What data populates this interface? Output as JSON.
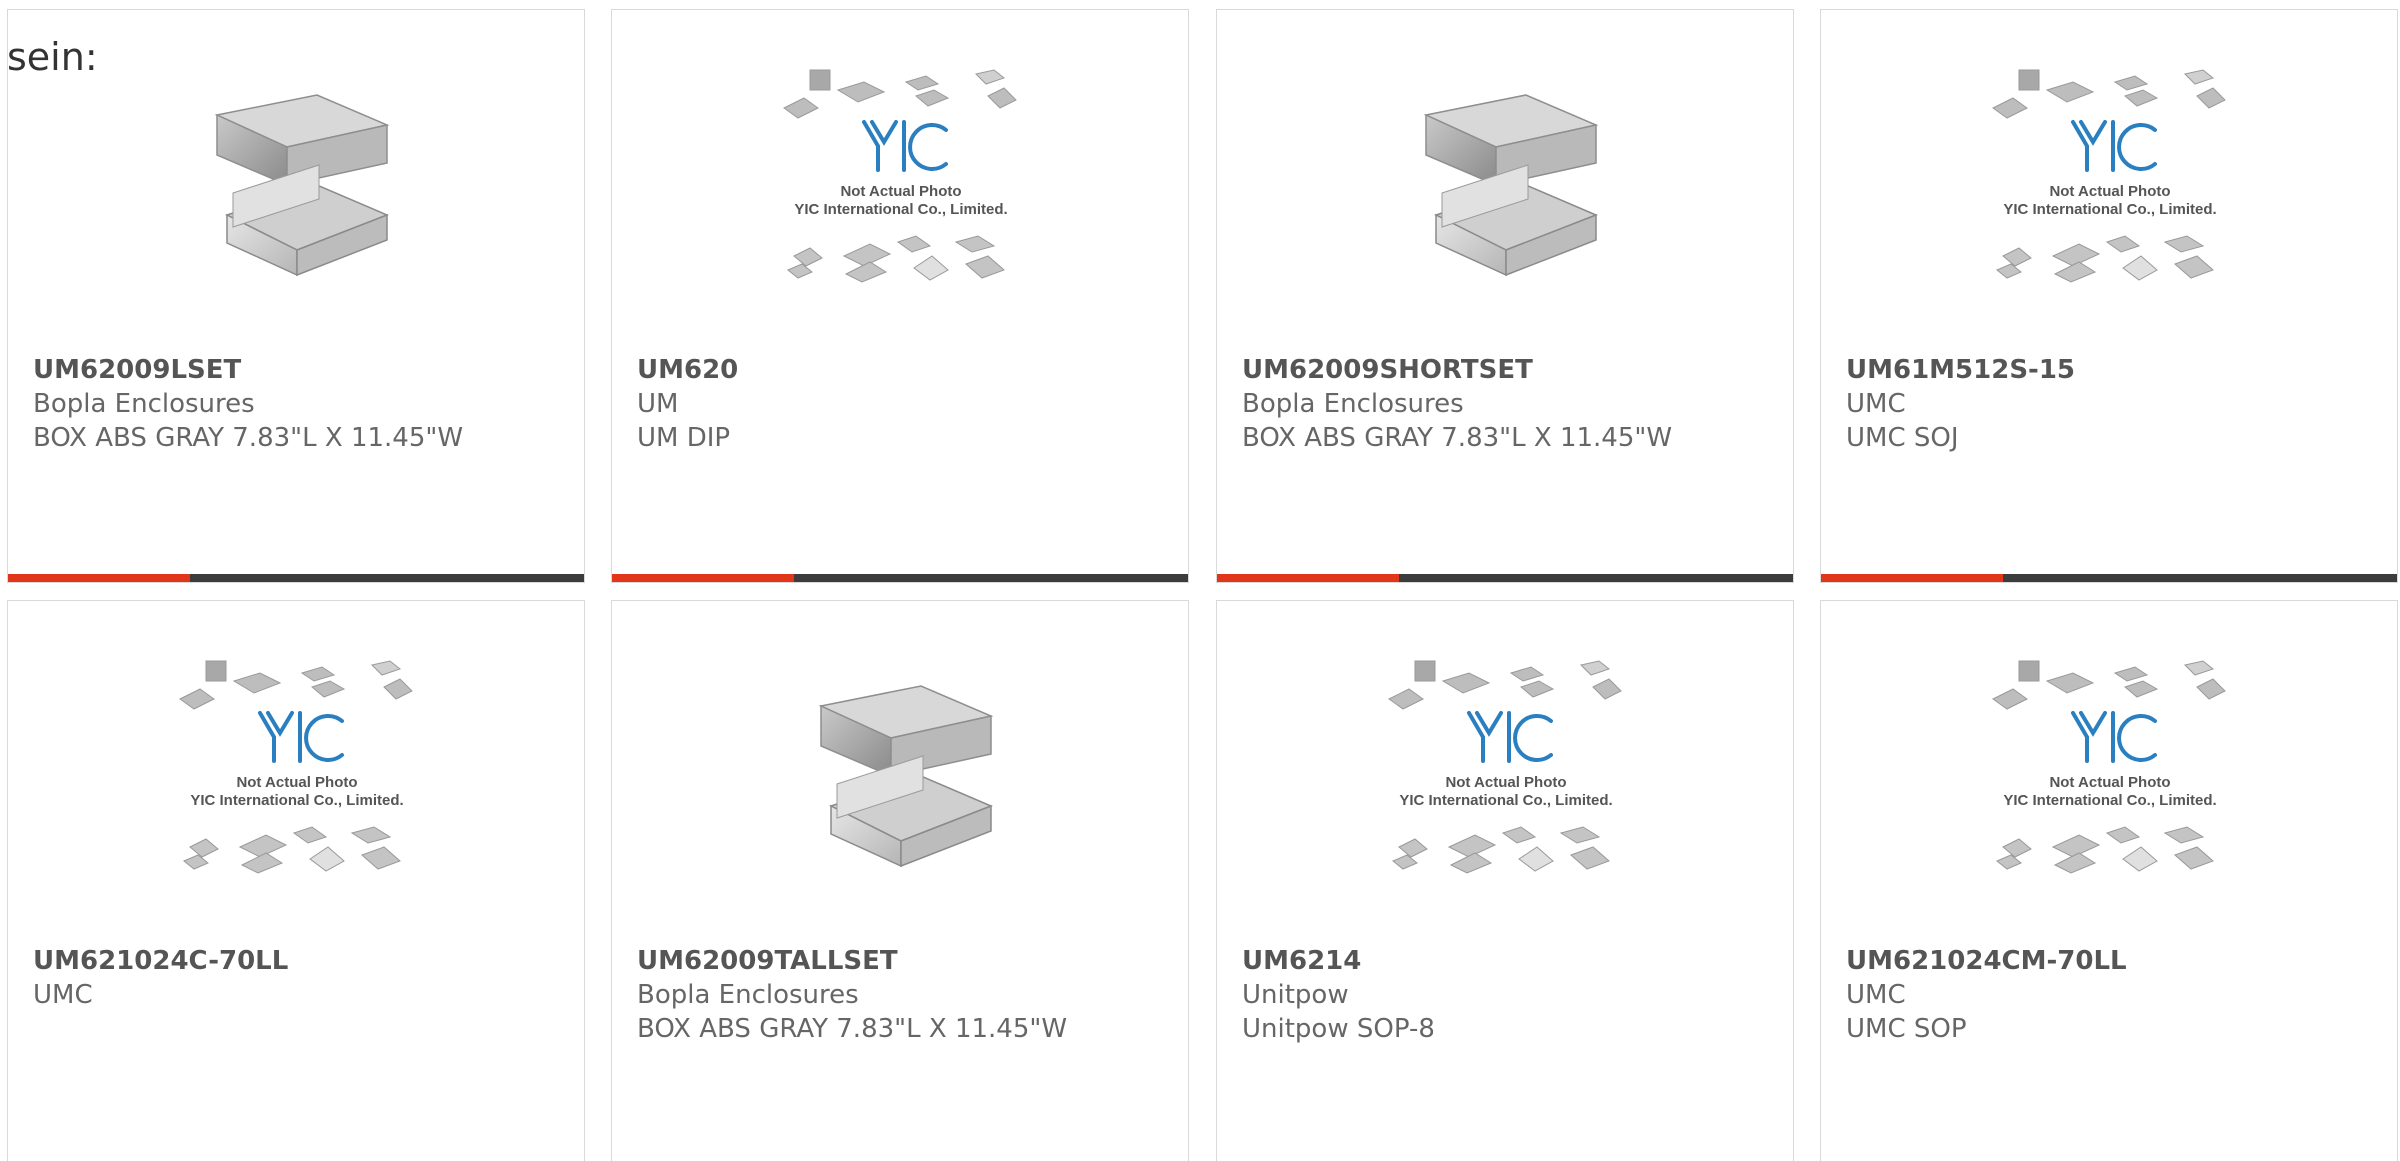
{
  "intro_text": "sein:",
  "colors": {
    "accent": "#e2361a",
    "bar": "#3c3c3c",
    "yic_blue": "#2a7fc0"
  },
  "placeholder": {
    "line1": "Not Actual Photo",
    "line2": "YIC International Co., Limited.",
    "logo": "YIC"
  },
  "products": [
    {
      "part": "UM62009LSET",
      "manufacturer": "Bopla Enclosures",
      "description": "BOX ABS GRAY 7.83\"L X 11.45\"W",
      "image": "enclosure-photo"
    },
    {
      "part": "UM620",
      "manufacturer": "UM",
      "description": "UM DIP",
      "image": "placeholder"
    },
    {
      "part": "UM62009SHORTSET",
      "manufacturer": "Bopla Enclosures",
      "description": "BOX ABS GRAY 7.83\"L X 11.45\"W",
      "image": "enclosure-photo"
    },
    {
      "part": "UM61M512S-15",
      "manufacturer": "UMC",
      "description": "UMC SOJ",
      "image": "placeholder"
    },
    {
      "part": "UM621024C-70LL",
      "manufacturer": "UMC",
      "description": "",
      "image": "placeholder"
    },
    {
      "part": "UM62009TALLSET",
      "manufacturer": "Bopla Enclosures",
      "description": "BOX ABS GRAY 7.83\"L X 11.45\"W",
      "image": "enclosure-photo"
    },
    {
      "part": "UM6214",
      "manufacturer": "Unitpow",
      "description": "Unitpow SOP-8",
      "image": "placeholder"
    },
    {
      "part": "UM621024CM-70LL",
      "manufacturer": "UMC",
      "description": "UMC SOP",
      "image": "placeholder"
    }
  ]
}
